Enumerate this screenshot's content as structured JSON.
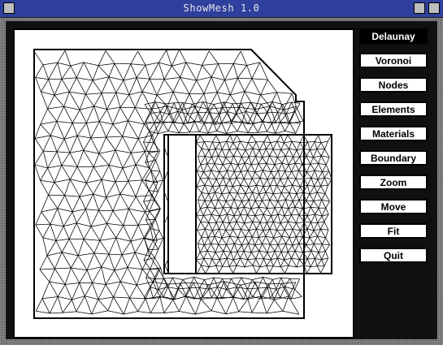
{
  "window": {
    "title": "ShowMesh 1.0"
  },
  "controls": {
    "buttons": [
      {
        "id": "delaunay",
        "label": "Delaunay",
        "active": true
      },
      {
        "id": "voronoi",
        "label": "Voronoi",
        "active": false
      },
      {
        "id": "nodes",
        "label": "Nodes",
        "active": false
      },
      {
        "id": "elements",
        "label": "Elements",
        "active": false
      },
      {
        "id": "materials",
        "label": "Materials",
        "active": false
      },
      {
        "id": "boundary",
        "label": "Boundary",
        "active": false
      },
      {
        "id": "zoom",
        "label": "Zoom",
        "active": false
      },
      {
        "id": "move",
        "label": "Move",
        "active": false
      },
      {
        "id": "fit",
        "label": "Fit",
        "active": false
      },
      {
        "id": "quit",
        "label": "Quit",
        "active": false
      }
    ]
  },
  "colors": {
    "titlebar": "#2f3f9d",
    "title_text": "#e9e9e9",
    "mesh": "#000000",
    "background": "#ffffff",
    "client": "#101010"
  },
  "icons": {
    "window_menu": "window-menu-icon",
    "minimize": "minimize-icon",
    "maximize": "maximize-icon"
  }
}
